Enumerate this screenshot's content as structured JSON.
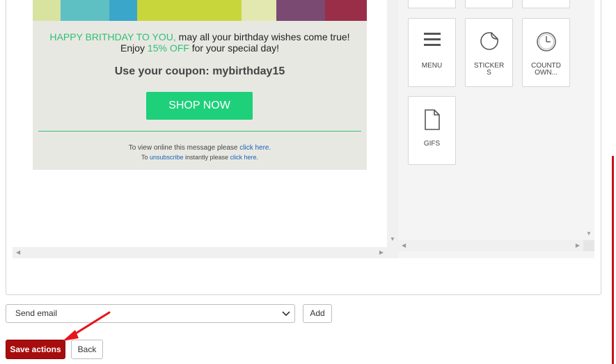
{
  "email": {
    "greeting_highlight": "HAPPY BRITHDAY TO YOU,",
    "greeting_rest": " may all your birthday wishes come true!",
    "enjoy_prefix": "Enjoy ",
    "discount": "15% OFF",
    "enjoy_suffix": " for your special day!",
    "coupon_text": "Use your coupon: mybirthday15",
    "shop_button": "SHOP NOW",
    "footer_line1_prefix": "To view online this message please ",
    "footer_line1_link": "click here.",
    "footer_line2_prefix": "To ",
    "footer_line2_unsub": "unsubscribe",
    "footer_line2_mid": " instantly please ",
    "footer_line2_link": "click here."
  },
  "palette": {
    "tiles": [
      {
        "label": "MENU",
        "icon": "menu-icon"
      },
      {
        "label": "STICKERS",
        "label_lines": [
          "STICKER",
          "S"
        ],
        "icon": "sticker-icon"
      },
      {
        "label": "COUNTDOWN...",
        "label_lines": [
          "COUNTD",
          "OWN..."
        ],
        "icon": "clock-icon"
      },
      {
        "label": "GIFS",
        "icon": "file-icon"
      }
    ]
  },
  "actions": {
    "select_value": "Send email",
    "add_label": "Add",
    "save_label": "Save actions",
    "back_label": "Back"
  },
  "colors": {
    "accent_green": "#1ed07a",
    "save_red": "#a80d0d",
    "link_blue": "#1a62b5"
  }
}
